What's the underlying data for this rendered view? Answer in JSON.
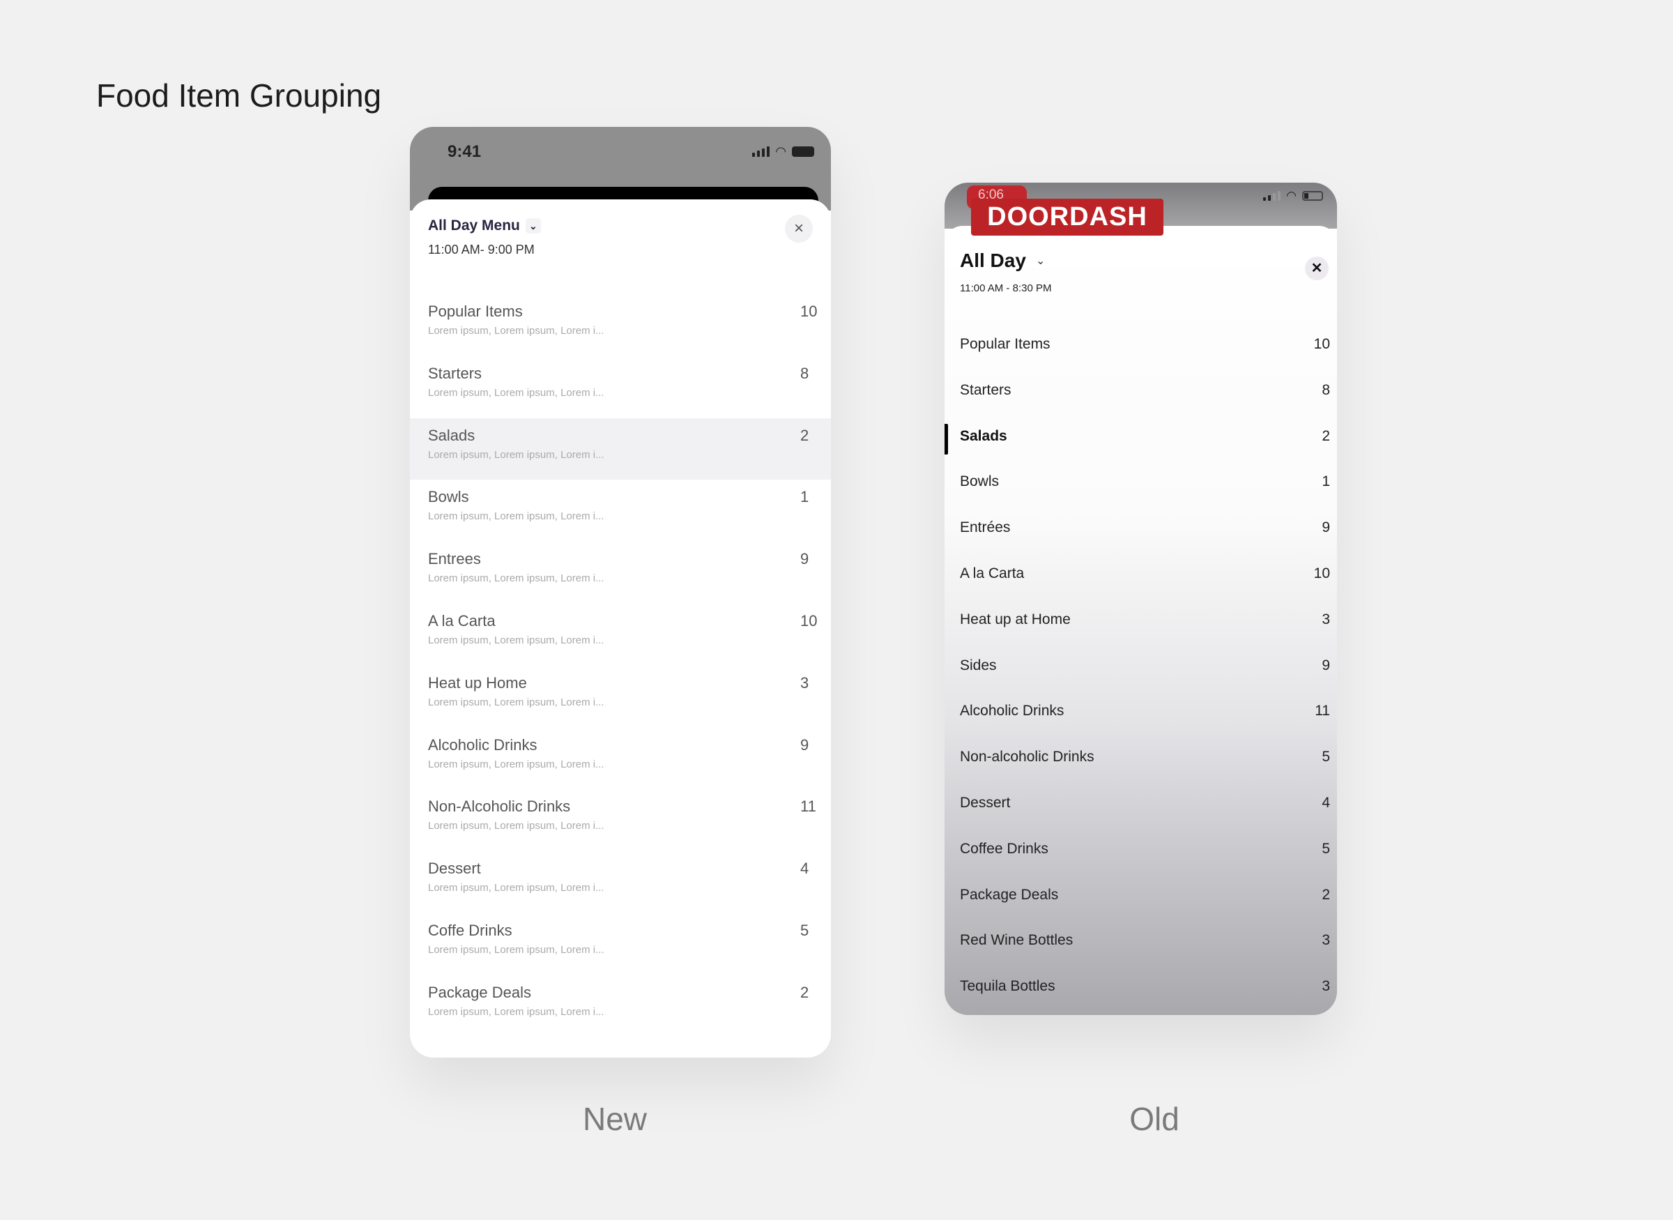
{
  "page_title": "Food Item Grouping",
  "new": {
    "caption": "New",
    "status_time": "9:41",
    "menu_title": "All Day Menu",
    "hours": "11:00 AM- 9:00 PM",
    "close_icon": "×",
    "chevron_icon": "⌄",
    "items": [
      {
        "name": "Popular Items",
        "sub": "Lorem ipsum, Lorem ipsum, Lorem i...",
        "count": "10"
      },
      {
        "name": "Starters",
        "sub": "Lorem ipsum, Lorem ipsum, Lorem i...",
        "count": "8"
      },
      {
        "name": "Salads",
        "sub": "Lorem ipsum, Lorem ipsum, Lorem i...",
        "count": "2",
        "active": true
      },
      {
        "name": "Bowls",
        "sub": "Lorem ipsum, Lorem ipsum, Lorem i...",
        "count": "1"
      },
      {
        "name": "Entrees",
        "sub": "Lorem ipsum, Lorem ipsum, Lorem i...",
        "count": "9"
      },
      {
        "name": "A la Carta",
        "sub": "Lorem ipsum, Lorem ipsum, Lorem i...",
        "count": "10"
      },
      {
        "name": "Heat up Home",
        "sub": "Lorem ipsum, Lorem ipsum, Lorem i...",
        "count": "3"
      },
      {
        "name": "Alcoholic Drinks",
        "sub": "Lorem ipsum, Lorem ipsum, Lorem i...",
        "count": "9"
      },
      {
        "name": "Non-Alcoholic Drinks",
        "sub": "Lorem ipsum, Lorem ipsum, Lorem i...",
        "count": "11"
      },
      {
        "name": "Dessert",
        "sub": "Lorem ipsum, Lorem ipsum, Lorem i...",
        "count": "4"
      },
      {
        "name": "Coffe Drinks",
        "sub": "Lorem ipsum, Lorem ipsum, Lorem i...",
        "count": "5"
      },
      {
        "name": "Package Deals",
        "sub": "Lorem ipsum, Lorem ipsum, Lorem i...",
        "count": "2"
      }
    ]
  },
  "old": {
    "caption": "Old",
    "status_time": "6:06",
    "brand": "DOORDASH",
    "brand_color": "#bb2326",
    "menu_title": "All Day",
    "hours": "11:00 AM - 8:30 PM",
    "close_icon": "✕",
    "chevron_icon": "⌄",
    "items": [
      {
        "name": "Popular Items",
        "count": "10"
      },
      {
        "name": "Starters",
        "count": "8"
      },
      {
        "name": "Salads",
        "count": "2",
        "active": true
      },
      {
        "name": "Bowls",
        "count": "1"
      },
      {
        "name": "Entrées",
        "count": "9"
      },
      {
        "name": "A la Carta",
        "count": "10"
      },
      {
        "name": "Heat up at Home",
        "count": "3"
      },
      {
        "name": "Sides",
        "count": "9"
      },
      {
        "name": "Alcoholic Drinks",
        "count": "11"
      },
      {
        "name": "Non-alcoholic Drinks",
        "count": "5"
      },
      {
        "name": "Dessert",
        "count": "4"
      },
      {
        "name": "Coffee Drinks",
        "count": "5"
      },
      {
        "name": "Package Deals",
        "count": "2"
      },
      {
        "name": "Red Wine Bottles",
        "count": "3"
      },
      {
        "name": "Tequila Bottles",
        "count": "3"
      }
    ]
  }
}
